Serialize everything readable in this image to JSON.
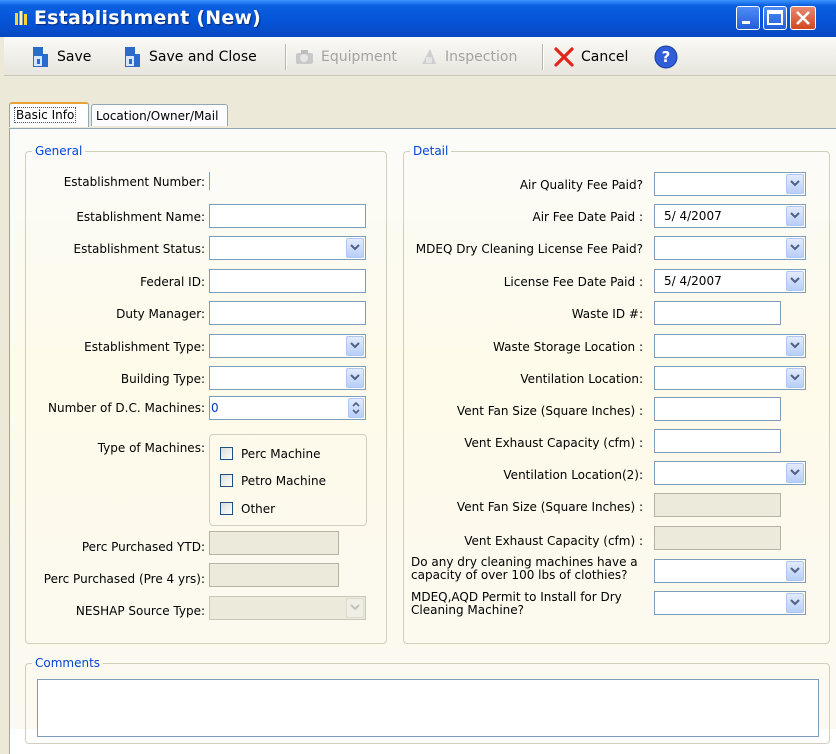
{
  "window": {
    "title": "Establishment (New)"
  },
  "toolbar": {
    "save": "Save",
    "save_close": "Save and Close",
    "equipment": "Equipment",
    "inspection": "Inspection",
    "cancel": "Cancel"
  },
  "tabs": [
    "Basic Info",
    "Location/Owner/Mail"
  ],
  "general": {
    "legend": "General",
    "establishment_number": {
      "label": "Establishment Number:",
      "value": ""
    },
    "establishment_name": {
      "label": "Establishment Name:",
      "value": ""
    },
    "establishment_status": {
      "label": "Establishment Status:",
      "value": ""
    },
    "federal_id": {
      "label": "Federal ID:",
      "value": ""
    },
    "duty_manager": {
      "label": "Duty Manager:",
      "value": ""
    },
    "establishment_type": {
      "label": "Establishment Type:",
      "value": ""
    },
    "building_type": {
      "label": "Building Type:",
      "value": ""
    },
    "num_dc_machines": {
      "label": "Number of D.C. Machines:",
      "value": "0"
    },
    "type_of_machines": {
      "label": "Type of Machines:",
      "options": [
        {
          "label": "Perc Machine",
          "checked": false
        },
        {
          "label": "Petro Machine",
          "checked": false
        },
        {
          "label": "Other",
          "checked": false
        }
      ]
    },
    "perc_purchased_ytd": {
      "label": "Perc Purchased YTD:",
      "value": ""
    },
    "perc_purchased_pre4": {
      "label": "Perc Purchased (Pre 4 yrs):",
      "value": ""
    },
    "neshap_source_type": {
      "label": "NESHAP Source Type:",
      "value": ""
    }
  },
  "detail": {
    "legend": "Detail",
    "air_quality_fee_paid": {
      "label": "Air Quality Fee Paid?",
      "value": ""
    },
    "air_fee_date_paid": {
      "label": "Air Fee Date Paid :",
      "value": "5/ 4/2007"
    },
    "mdeq_license_fee_paid": {
      "label": "MDEQ Dry Cleaning License Fee Paid?",
      "value": ""
    },
    "license_fee_date_paid": {
      "label": "License Fee Date Paid :",
      "value": "5/ 4/2007"
    },
    "waste_id": {
      "label": "Waste ID #:",
      "value": ""
    },
    "waste_storage_location": {
      "label": "Waste Storage Location :",
      "value": ""
    },
    "ventilation_location": {
      "label": "Ventilation Location:",
      "value": ""
    },
    "vent_fan_size": {
      "label": "Vent Fan Size (Square Inches) :",
      "value": ""
    },
    "vent_exhaust_capacity": {
      "label": "Vent Exhaust Capacity (cfm) :",
      "value": ""
    },
    "ventilation_location2": {
      "label": "Ventilation Location(2):",
      "value": ""
    },
    "vent_fan_size2": {
      "label": "Vent Fan Size (Square Inches) :",
      "value": ""
    },
    "vent_exhaust_capacity2": {
      "label": "Vent Exhaust Capacity (cfm) :",
      "value": ""
    },
    "over_100lbs": {
      "label_line1": "Do any dry cleaning machines have a",
      "label_line2": "capacity of over 100 lbs of clothies?",
      "value": ""
    },
    "permit_to_install": {
      "label_line1": "MDEQ,AQD Permit to Install for Dry",
      "label_line2": "Cleaning Machine?",
      "value": ""
    }
  },
  "comments": {
    "legend": "Comments",
    "value": ""
  }
}
